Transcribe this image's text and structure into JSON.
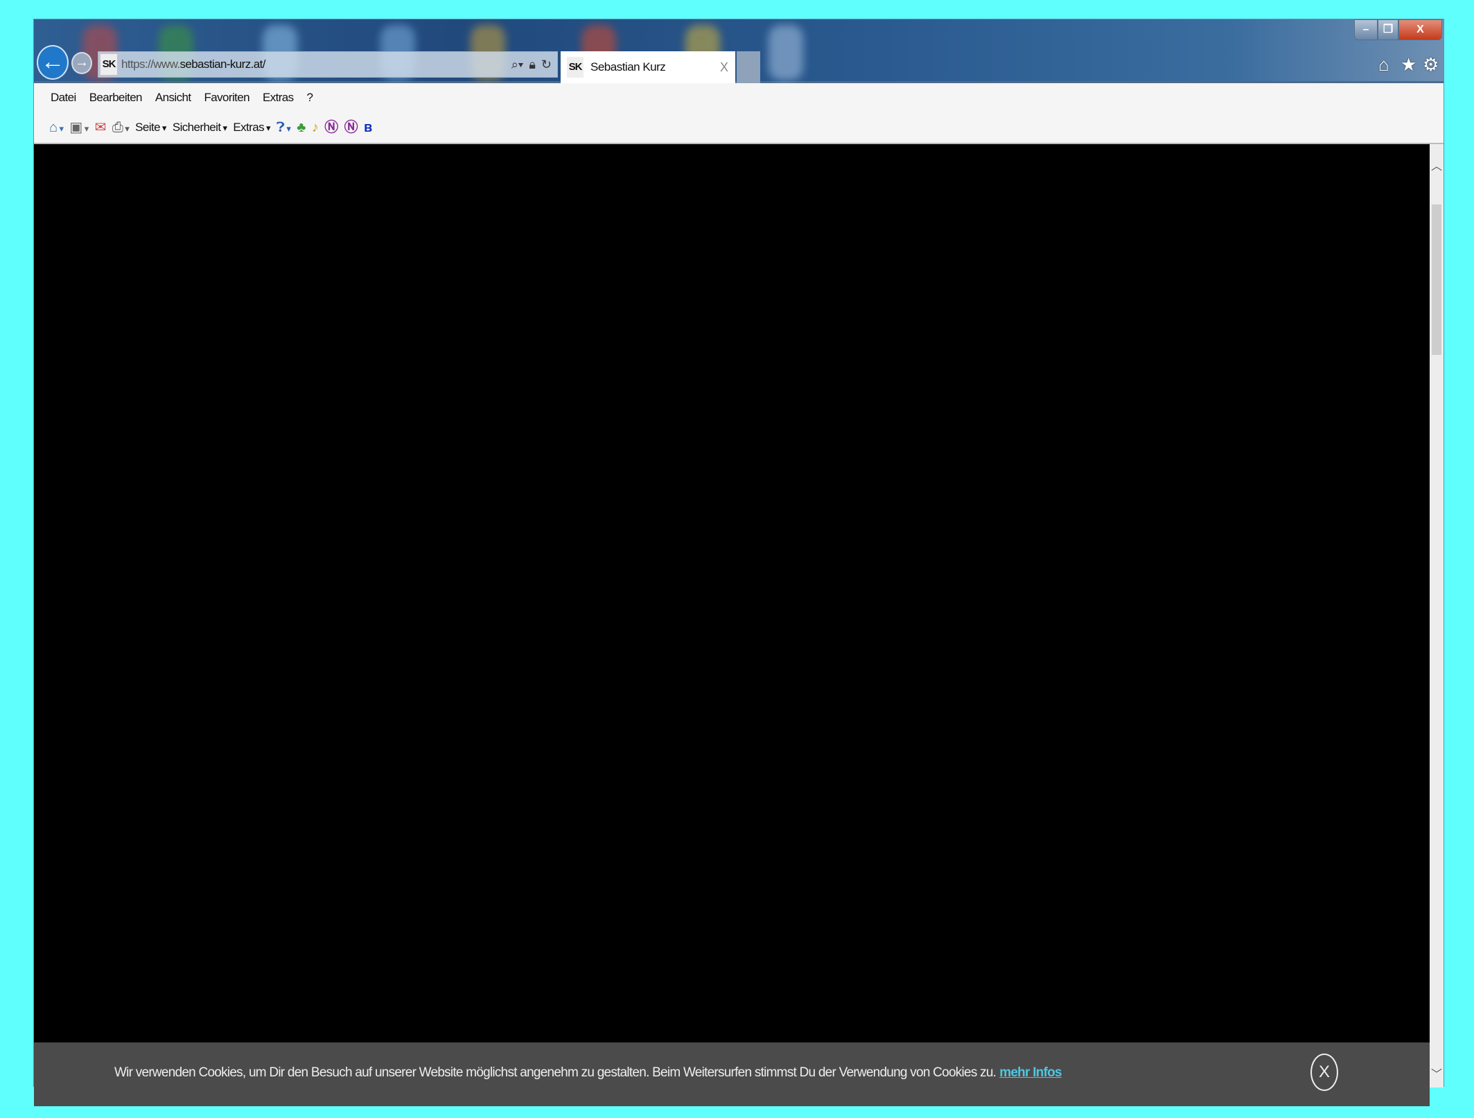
{
  "window": {
    "controls": {
      "minimize": "–",
      "restore": "❐",
      "close": "X"
    }
  },
  "nav": {
    "back_icon": "←",
    "forward_icon": "→"
  },
  "address_bar": {
    "favicon": "SK",
    "url_prefix": "https://www.",
    "url_rest": "sebastian-kurz.at/"
  },
  "tab": {
    "favicon": "SK",
    "title": "Sebastian Kurz",
    "close": "X"
  },
  "menu": [
    "Datei",
    "Bearbeiten",
    "Ansicht",
    "Favoriten",
    "Extras",
    "?"
  ],
  "toolbar": {
    "page": "Seite",
    "safety": "Sicherheit",
    "extras": "Extras"
  },
  "cookie_banner": {
    "text": "Wir verwenden Cookies, um Dir den Besuch auf unserer Website möglichst angenehm zu gestalten. Beim Weitersurfen stimmst Du der Verwendung von Cookies zu.",
    "link": "mehr Infos",
    "close": "X"
  }
}
